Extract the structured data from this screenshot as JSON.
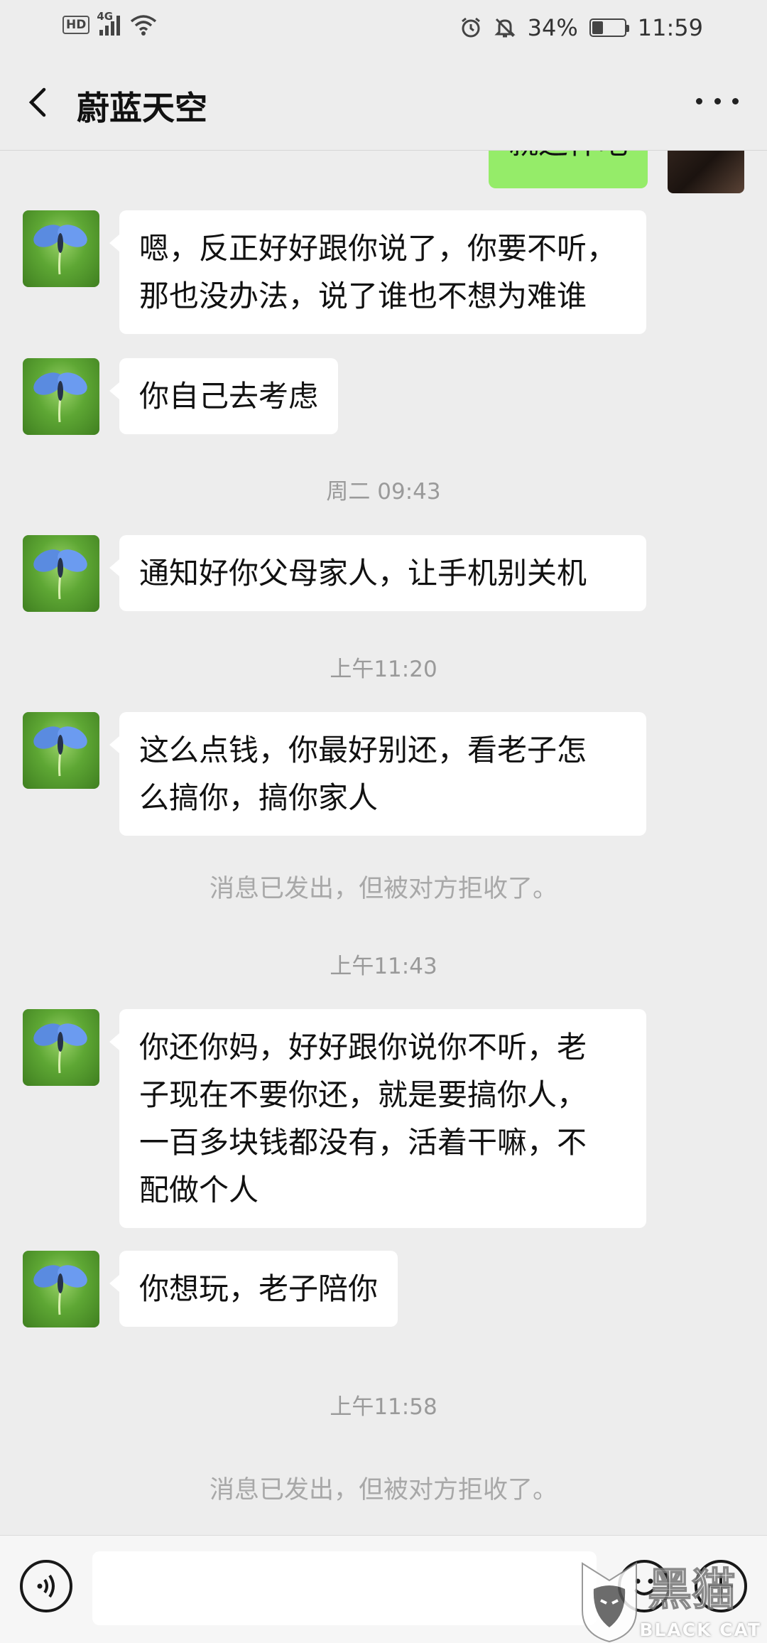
{
  "status_bar": {
    "hd": "HD",
    "network": "4G",
    "battery_percent": "34%",
    "battery_level": 0.34,
    "time": "11:59",
    "icons": [
      "hd-icon",
      "signal-icon",
      "wifi-icon",
      "alarm-icon",
      "mute-icon",
      "battery-icon"
    ]
  },
  "header": {
    "title": "蔚蓝天空",
    "back_icon": "back-arrow-icon",
    "more_icon": "more-dots-icon"
  },
  "chat": {
    "sent_partial": "就这样吧",
    "messages": [
      {
        "type": "received",
        "lines": [
          "嗯，反正好好跟你说了，你要不听，",
          "那也没办法，说了谁也不想为难谁"
        ]
      },
      {
        "type": "received",
        "lines": [
          "你自己去考虑"
        ]
      },
      {
        "type": "time",
        "text": "周二 09:43"
      },
      {
        "type": "received",
        "lines": [
          "通知好你父母家人，让手机别关机"
        ]
      },
      {
        "type": "time",
        "text": "上午11:20"
      },
      {
        "type": "received",
        "lines": [
          "这么点钱，你最好别还，看老子怎",
          "么搞你，搞你家人"
        ]
      },
      {
        "type": "system",
        "text": "消息已发出，但被对方拒收了。"
      },
      {
        "type": "time",
        "text": "上午11:43"
      },
      {
        "type": "received",
        "lines": [
          "你还你妈，好好跟你说你不听，老",
          "子现在不要你还，就是要搞你人，",
          "一百多块钱都没有，活着干嘛，不",
          "配做个人"
        ]
      },
      {
        "type": "received",
        "lines": [
          "你想玩，老子陪你"
        ]
      },
      {
        "type": "time",
        "text": "上午11:58"
      },
      {
        "type": "system",
        "text": "消息已发出，但被对方拒收了。"
      }
    ]
  },
  "input_bar": {
    "voice_icon": "voice-icon",
    "emoji_icon": "emoji-icon",
    "plus_icon": "plus-icon"
  },
  "watermark": {
    "cn": "黑猫",
    "en": "BLACK CAT"
  }
}
